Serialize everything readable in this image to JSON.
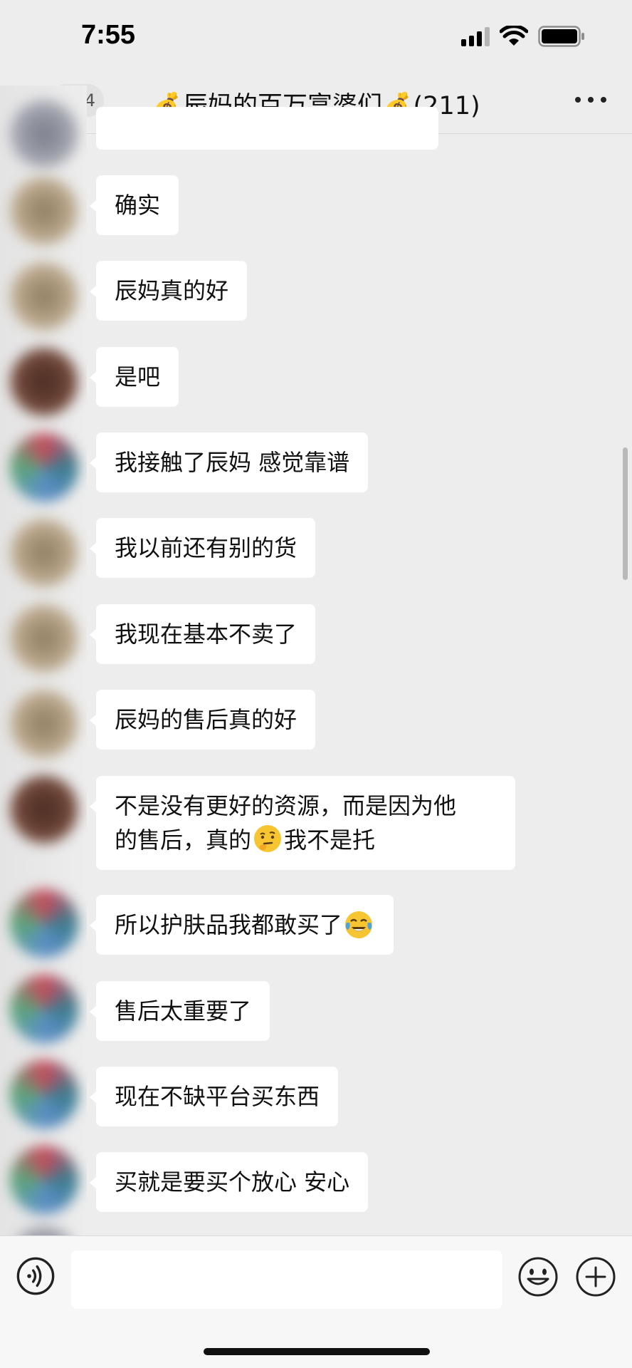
{
  "status_bar": {
    "time": "7:55"
  },
  "nav": {
    "back_label": "4",
    "title": "💰辰妈的百万富婆们💰(211)",
    "icons": [
      "signal-icon",
      "wifi-icon",
      "battery-icon",
      "more-icon"
    ]
  },
  "messages": [
    {
      "text": ""
    },
    {
      "text": "确实"
    },
    {
      "text": "辰妈真的好"
    },
    {
      "text": "是吧"
    },
    {
      "text": "我接触了辰妈 感觉靠谱"
    },
    {
      "text": "我以前还有别的货"
    },
    {
      "text": "我现在基本不卖了"
    },
    {
      "text": "辰妈的售后真的好"
    },
    {
      "line1": "不是没有更好的资源，而是因为他",
      "line2a": "的售后，真的",
      "line2b": "我不是托",
      "emoji": "thinking-face"
    },
    {
      "text": "所以护肤品我都敢买了",
      "emoji": "tears-of-joy"
    },
    {
      "text": "售后太重要了"
    },
    {
      "text": "现在不缺平台买东西"
    },
    {
      "text": "买就是要买个放心 安心"
    }
  ],
  "input_bar": {
    "placeholder": "",
    "icons": [
      "voice-icon",
      "emoji-icon",
      "plus-icon"
    ]
  },
  "colors": {
    "background": "#ededed",
    "bubble": "#ffffff",
    "text": "#111111"
  }
}
